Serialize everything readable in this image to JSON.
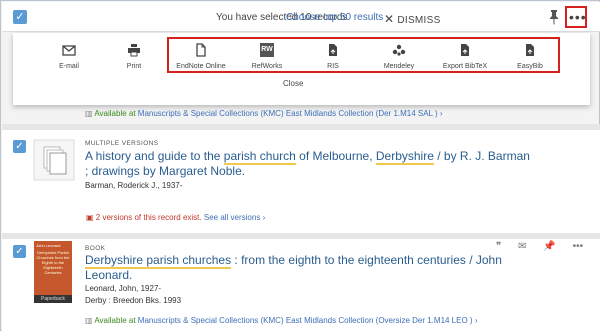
{
  "selection_bar": {
    "selected_text": "You have selected 10 records",
    "top50_link": "Choose top 50 results",
    "dismiss_label": "DISMISS"
  },
  "actions_panel": {
    "items": [
      {
        "label": "E-mail",
        "icon": "email-icon"
      },
      {
        "label": "Print",
        "icon": "print-icon"
      },
      {
        "label": "EndNote Online",
        "icon": "document-icon"
      },
      {
        "label": "RefWorks",
        "icon": "refworks-icon"
      },
      {
        "label": "RIS",
        "icon": "export-file-icon"
      },
      {
        "label": "Mendeley",
        "icon": "mendeley-icon"
      },
      {
        "label": "Export BibTeX",
        "icon": "export-file-icon"
      },
      {
        "label": "EasyBib",
        "icon": "export-file-icon"
      }
    ],
    "close_label": "Close",
    "refworks_badge": "RW"
  },
  "record1_availability": {
    "status": "Available at",
    "location": "Manuscripts & Special Collections (KMC)  East Midlands Collection (Der 1.M14 SAL )"
  },
  "record2": {
    "type": "MULTIPLE VERSIONS",
    "title_a": "A history and guide to the ",
    "title_hl1": "parish church",
    "title_b": " of Melbourne, ",
    "title_hl2": "Derbyshire",
    "title_c": " / by R. J. Barman",
    "title_line2": "; drawings by Margaret Noble.",
    "author": "Barman, Roderick J., 1937-",
    "versions_text": "2 versions of this record exist.",
    "versions_link": "See all versions"
  },
  "record3": {
    "type": "BOOK",
    "title_hl": "Derbyshire parish churches",
    "title_rest": " : from the eighth to the eighteenth centuries / John",
    "title_line2": "Leonard.",
    "author": "Leonard, John, 1927-",
    "publisher": "Derby : Breedon Bks. 1993",
    "cover_author": "John Leonard",
    "cover_title": "Derbyshire Parish Churches from the Eighth to the Eighteenth Centuries",
    "cover_band": "Paperback",
    "availability_status": "Available at",
    "availability_location": "Manuscripts & Special Collections (KMC)  East Midlands Collection (Oversize Der 1.M14 LEO )"
  },
  "colors": {
    "accent_blue": "#3d6fb6",
    "highlight_red": "#d6201c",
    "available_green": "#3a8a1f",
    "checkbox_blue": "#5b9bd5"
  }
}
